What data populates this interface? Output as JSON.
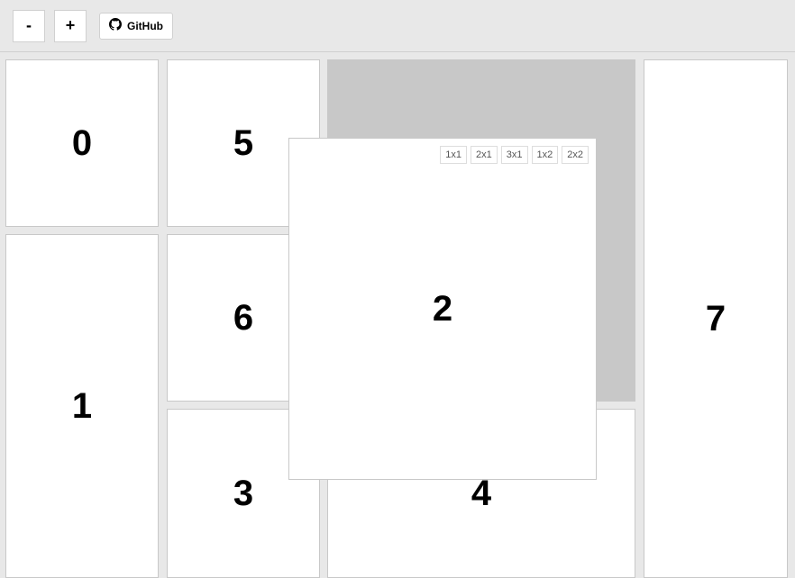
{
  "toolbar": {
    "minus_label": "-",
    "plus_label": "+",
    "github_label": "GitHub"
  },
  "grid": {
    "cells": [
      {
        "id": "0",
        "label": "0"
      },
      {
        "id": "1",
        "label": "1"
      },
      {
        "id": "2",
        "label": "2"
      },
      {
        "id": "3",
        "label": "3"
      },
      {
        "id": "4",
        "label": "4"
      },
      {
        "id": "5",
        "label": "5"
      },
      {
        "id": "6",
        "label": "6"
      },
      {
        "id": "7",
        "label": "7"
      }
    ],
    "size_options": [
      "1x1",
      "2x1",
      "3x1",
      "1x2",
      "2x2"
    ]
  }
}
